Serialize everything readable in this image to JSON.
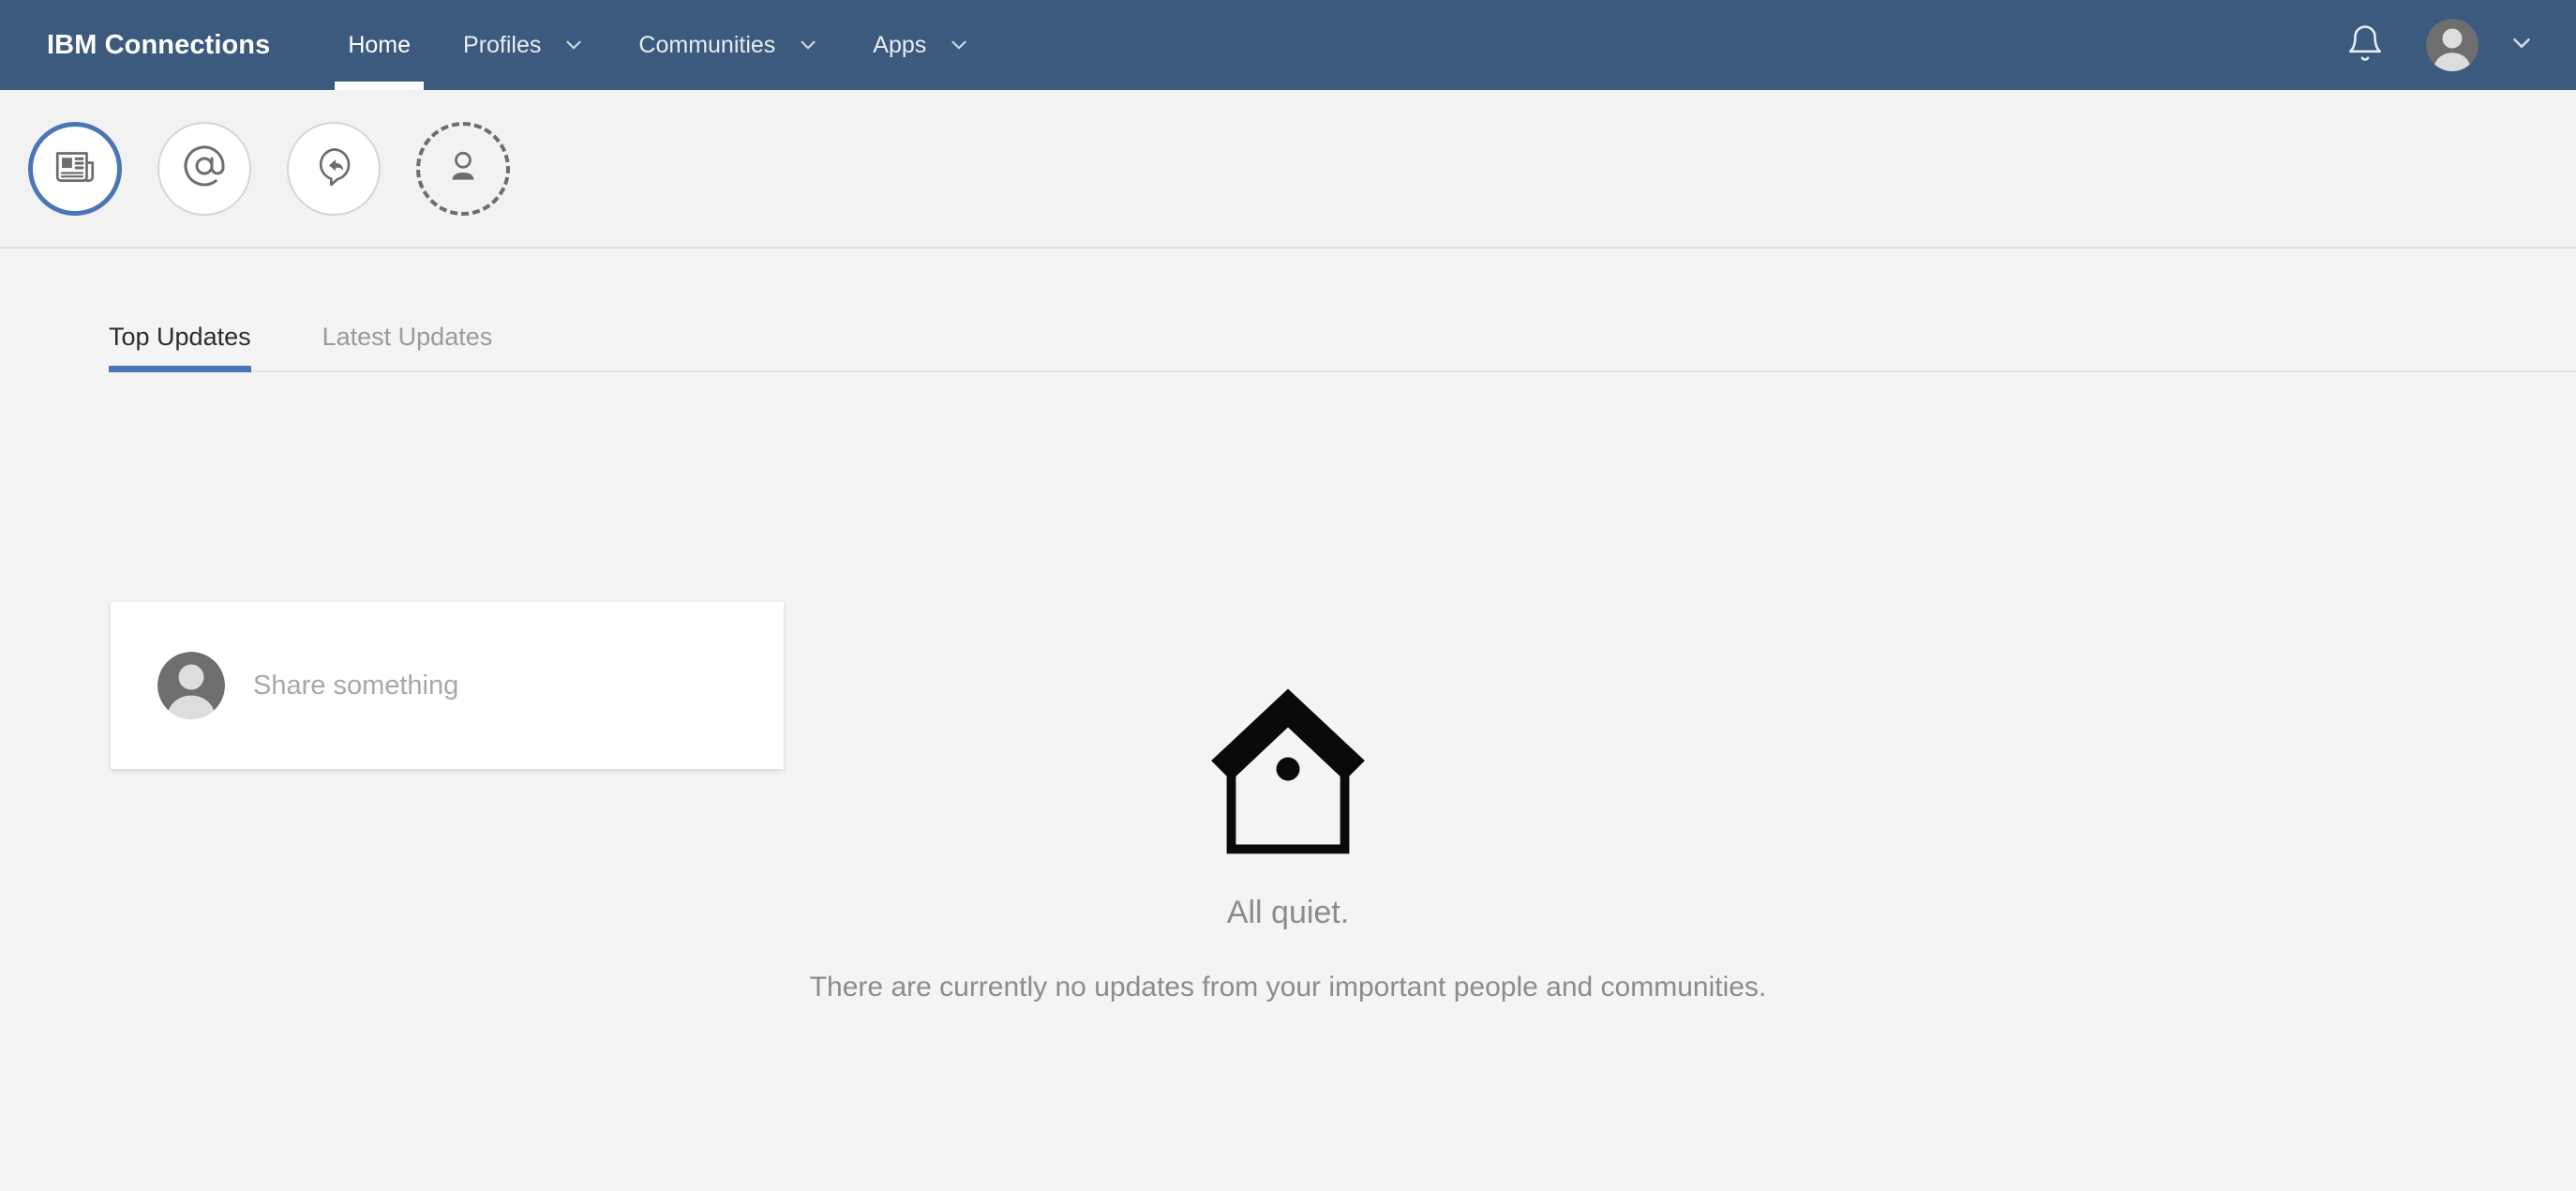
{
  "header": {
    "brand": "IBM Connections",
    "nav": [
      {
        "label": "Home",
        "has_caret": false,
        "active": true,
        "icon": ""
      },
      {
        "label": "Profiles",
        "has_caret": true,
        "active": false,
        "icon": "chevron-down-icon"
      },
      {
        "label": "Communities",
        "has_caret": true,
        "active": false,
        "icon": "chevron-down-icon"
      },
      {
        "label": "Apps",
        "has_caret": true,
        "active": false,
        "icon": "chevron-down-icon"
      }
    ],
    "notifications_icon": "bell-icon",
    "avatar_icon": "user-avatar",
    "account_caret_icon": "chevron-down-icon",
    "background_color": "#3b5a7d",
    "text_color": "#ffffff"
  },
  "filters": [
    {
      "name": "updates",
      "icon": "newspaper-icon",
      "selected": true
    },
    {
      "name": "mentions",
      "icon": "at-mention-icon",
      "selected": false
    },
    {
      "name": "responses",
      "icon": "reply-bubble-icon",
      "selected": false
    },
    {
      "name": "people",
      "icon": "person-dashed-icon",
      "selected": false
    }
  ],
  "tabs": [
    {
      "label": "Top Updates",
      "active": true
    },
    {
      "label": "Latest Updates",
      "active": false
    }
  ],
  "share_box": {
    "placeholder": "Share something",
    "avatar_icon": "user-avatar"
  },
  "empty_state": {
    "icon": "birdhouse-icon",
    "title": "All quiet.",
    "message": "There are currently no updates from your important people and communities."
  },
  "colors": {
    "header_bg": "#3b5a7d",
    "page_bg": "#f4f4f4",
    "filter_bar_bg": "#f2f2f2",
    "accent_blue": "#4a76b8",
    "muted_text": "#8c8c8c",
    "card_bg": "#ffffff"
  }
}
